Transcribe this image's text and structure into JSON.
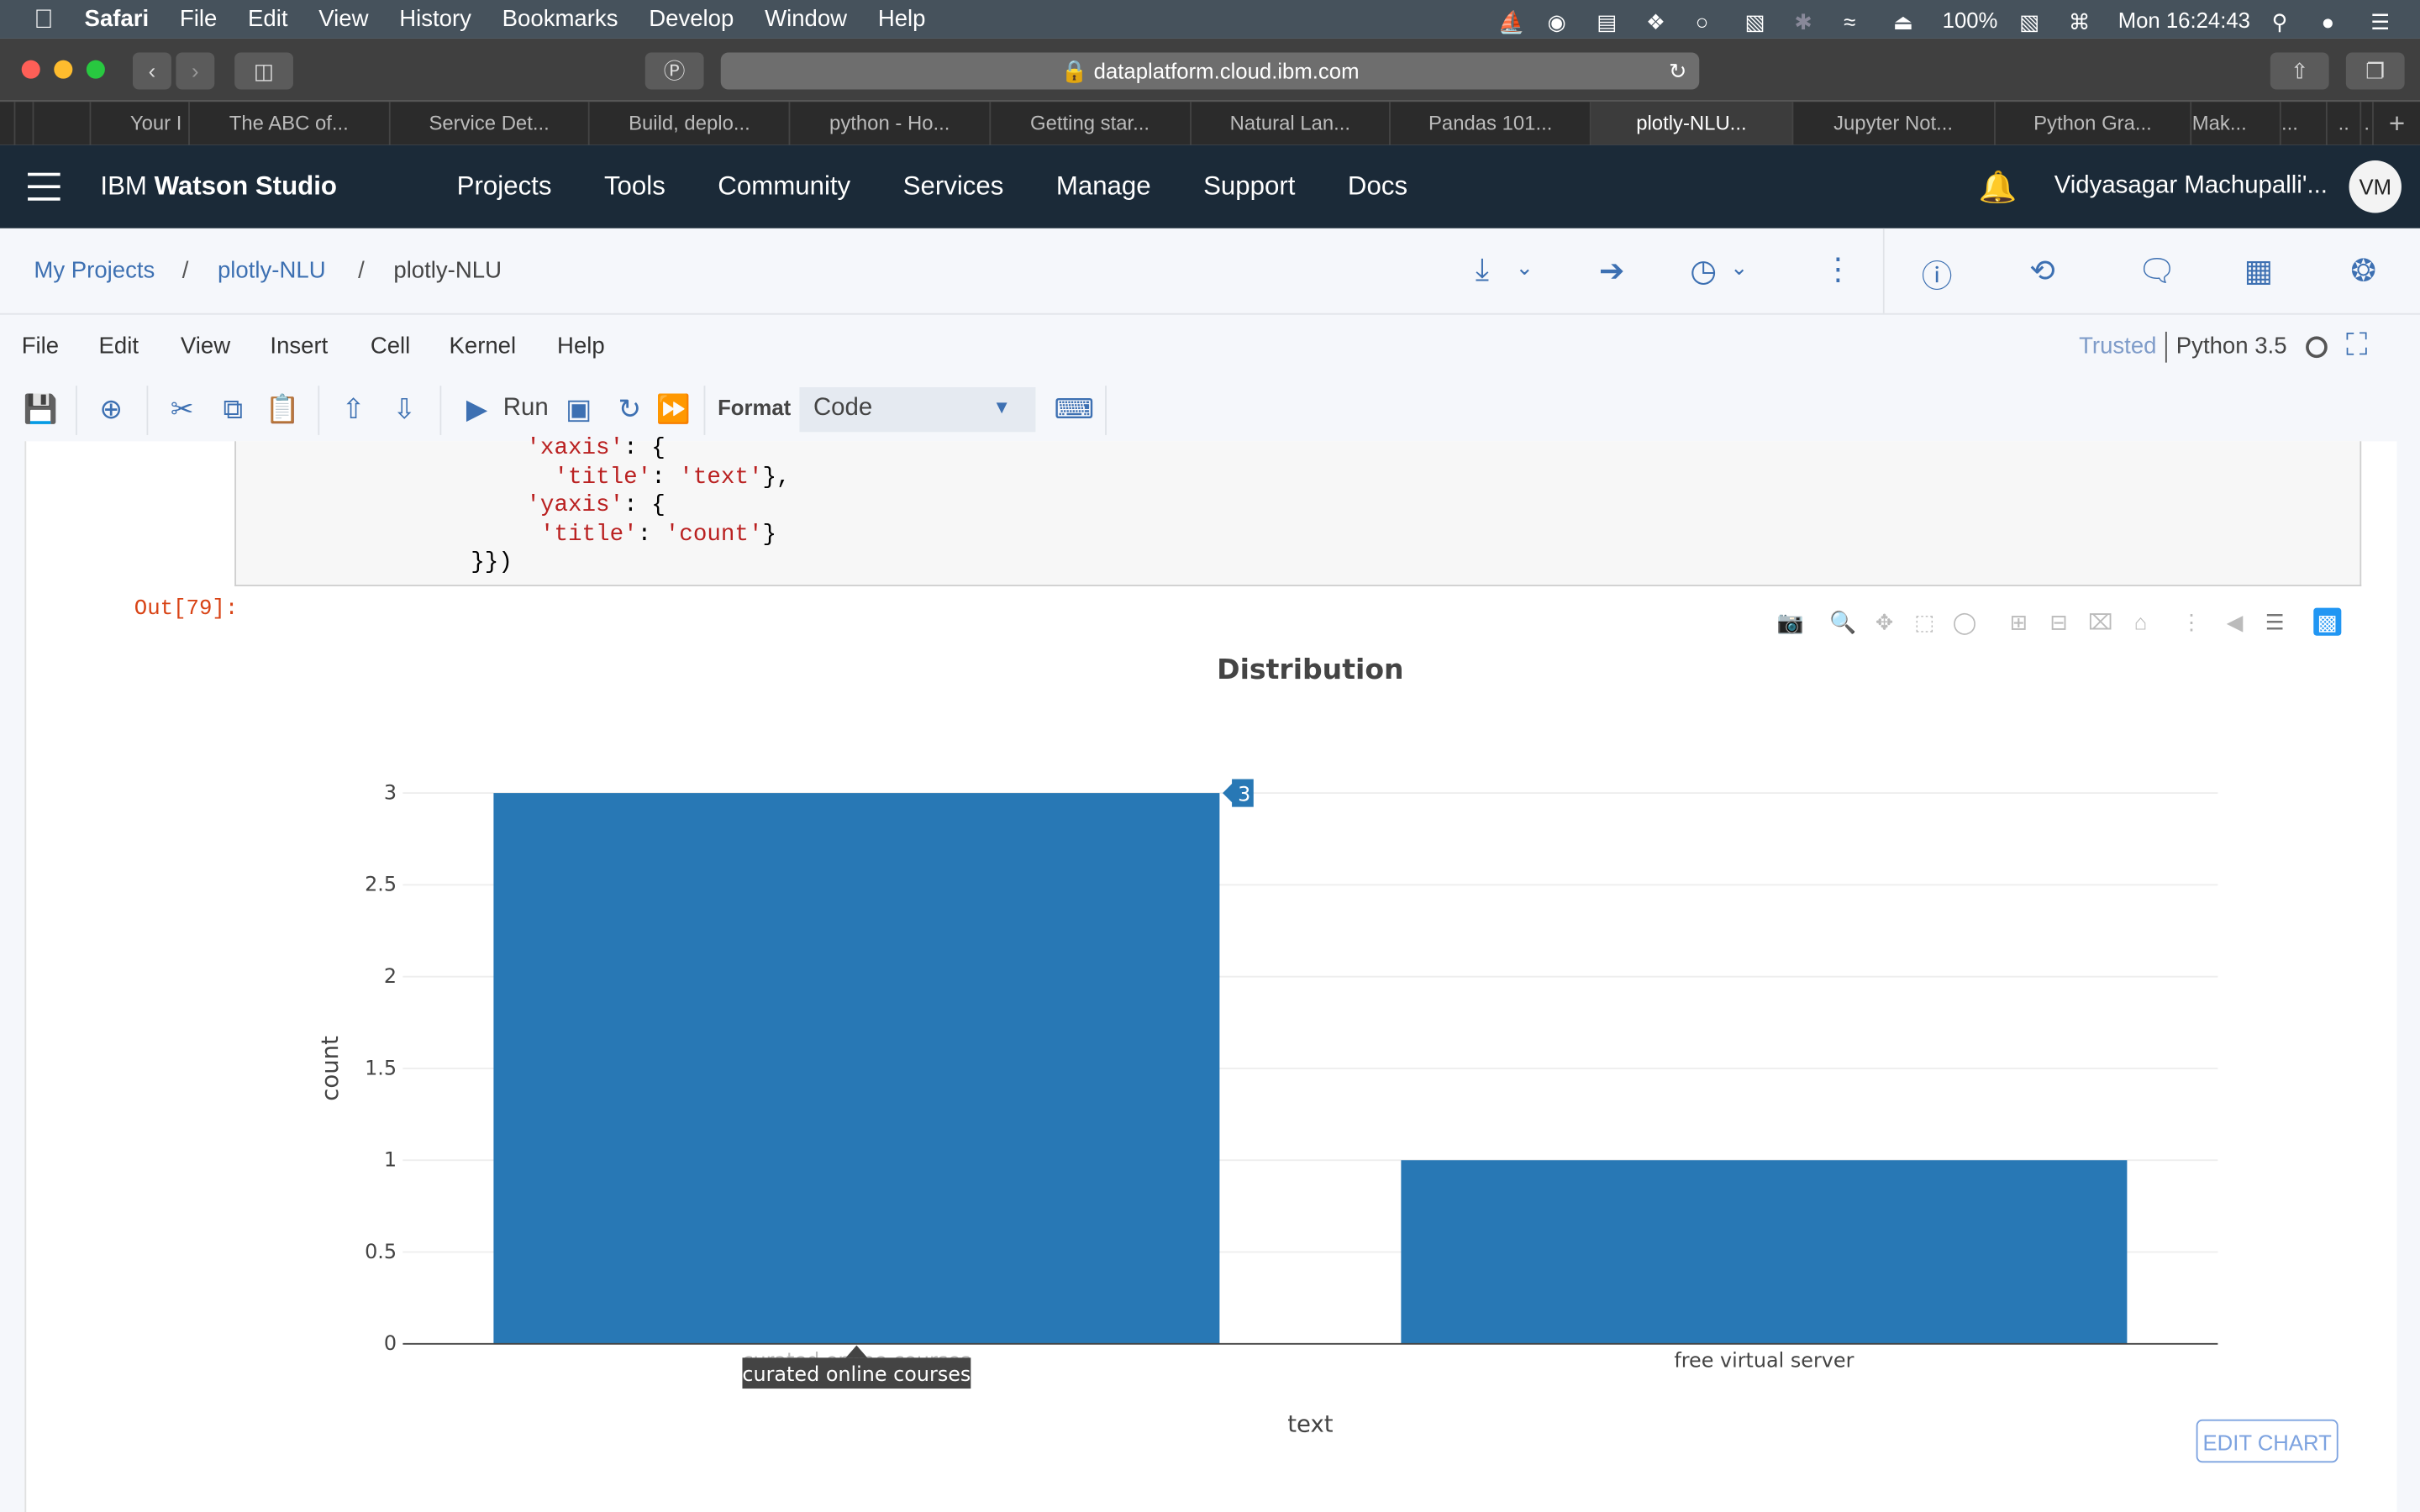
{
  "mac_menubar": {
    "app": "Safari",
    "items": [
      "File",
      "Edit",
      "View",
      "History",
      "Bookmarks",
      "Develop",
      "Window",
      "Help"
    ],
    "battery": "100%",
    "clock": "Mon 16:24:43",
    "status_icons": [
      "docker-icon",
      "creative-cloud-icon",
      "storage-icon",
      "dropbox-icon",
      "browser-extension-icon",
      "binoculars-icon",
      "bluetooth-icon",
      "wifi-icon",
      "eject-icon",
      "battery-icon",
      "keyboard-icon",
      "spotlight-search-icon",
      "siri-icon",
      "notification-center-icon"
    ]
  },
  "browser": {
    "url": "dataplatform.cloud.ibm.com",
    "tabs": [
      {
        "label": ""
      },
      {
        "label": "Your I"
      },
      {
        "label": "The ABC of..."
      },
      {
        "label": "Service Det..."
      },
      {
        "label": "Build, deplo..."
      },
      {
        "label": "python - Ho..."
      },
      {
        "label": "Getting star..."
      },
      {
        "label": "Natural Lan..."
      },
      {
        "label": "Pandas 101..."
      },
      {
        "label": "plotly-NLU...",
        "active": true
      },
      {
        "label": "Jupyter Not..."
      },
      {
        "label": "Python Gra..."
      },
      {
        "label": "Mak..."
      },
      {
        "label": "..."
      },
      {
        "label": ".."
      },
      {
        "label": "."
      }
    ],
    "new_tab": "+"
  },
  "app_header": {
    "brand_prefix": "IBM ",
    "brand_name": "Watson Studio",
    "nav": [
      "Projects",
      "Tools",
      "Community",
      "Services",
      "Manage",
      "Support",
      "Docs"
    ],
    "user_name": "Vidyasagar Machupalli'...",
    "avatar_initials": "VM"
  },
  "breadcrumb": {
    "items": [
      "My Projects",
      "plotly-NLU",
      "plotly-NLU"
    ],
    "separator": "/"
  },
  "notebook": {
    "menu": [
      "File",
      "Edit",
      "View",
      "Insert",
      "Cell",
      "Kernel",
      "Help"
    ],
    "trusted": "Trusted",
    "kernel": "Python 3.5",
    "run_label": "Run",
    "format_label": "Format",
    "format_value": "Code",
    "code_lines": [
      {
        "indent": "        ",
        "parts": [
          {
            "t": "'xaxis'",
            "c": "str"
          },
          {
            "t": ": {",
            "c": "pun"
          }
        ]
      },
      {
        "indent": "          ",
        "parts": [
          {
            "t": "'title'",
            "c": "str"
          },
          {
            "t": ": ",
            "c": "pun"
          },
          {
            "t": "'text'",
            "c": "str"
          },
          {
            "t": "},",
            "c": "pun"
          }
        ]
      },
      {
        "indent": "        ",
        "parts": [
          {
            "t": "'yaxis'",
            "c": "str"
          },
          {
            "t": ": {",
            "c": "pun"
          }
        ]
      },
      {
        "indent": "         ",
        "parts": [
          {
            "t": "'title'",
            "c": "str"
          },
          {
            "t": ": ",
            "c": "pun"
          },
          {
            "t": "'count'",
            "c": "str"
          },
          {
            "t": "}",
            "c": "pun"
          }
        ]
      },
      {
        "indent": "    ",
        "parts": [
          {
            "t": "}})",
            "c": "pun"
          }
        ]
      }
    ],
    "output_prompt": "Out[79]:",
    "edit_chart_label": "EDIT CHART",
    "modebar_icons": [
      "camera-icon",
      "zoom-icon",
      "pan-icon",
      "box-select-icon",
      "lasso-select-icon",
      "zoom-in-icon",
      "zoom-out-icon",
      "autoscale-icon",
      "reset-axes-icon",
      "toggle-spike-lines-icon",
      "hover-closest-icon",
      "hover-compare-icon",
      "plotly-logo-icon"
    ]
  },
  "colors": {
    "bar": "#2878b5",
    "header_bg": "#1b2a38",
    "accent": "#3d70b2",
    "prompt_out": "#d84315"
  },
  "chart_data": {
    "type": "bar",
    "title": "Distribution",
    "xlabel": "text",
    "ylabel": "count",
    "categories": [
      "curated online courses",
      "free virtual server"
    ],
    "values": [
      3,
      1
    ],
    "ylim": [
      0,
      3
    ],
    "yticks": [
      0,
      0.5,
      1,
      1.5,
      2,
      2.5,
      3
    ],
    "ytick_labels": [
      "0",
      "0.5",
      "1",
      "1.5",
      "2",
      "2.5",
      "3"
    ],
    "grid": true,
    "hover": {
      "category": "curated online courses",
      "value_label": "3"
    }
  }
}
